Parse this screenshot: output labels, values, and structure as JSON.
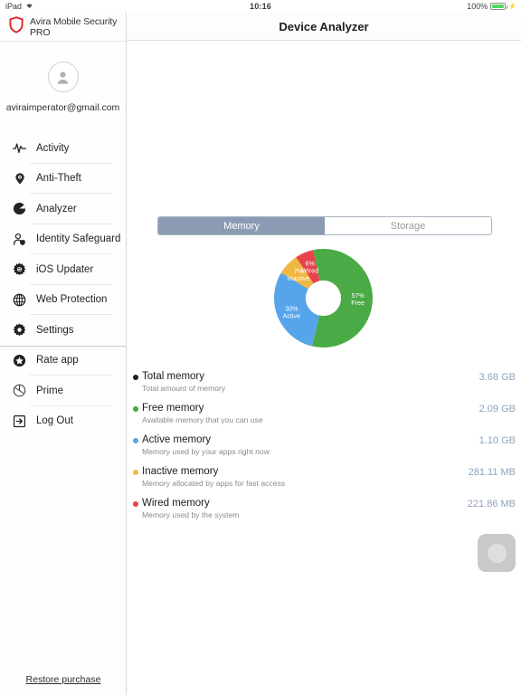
{
  "status_bar": {
    "device": "iPad",
    "wifi_icon": "wifi-icon",
    "time": "10:16",
    "battery_percent": "100%",
    "battery_level": 100,
    "charging": true
  },
  "sidebar": {
    "brand": {
      "logo_icon": "avira-shield-icon",
      "label": "Avira Mobile Security PRO",
      "logo_color": "#e1242a"
    },
    "account": {
      "avatar_icon": "user-avatar-icon",
      "email": "aviraimperator@gmail.com"
    },
    "items": [
      {
        "label": "Activity",
        "icon": "pulse-icon"
      },
      {
        "label": "Anti-Theft",
        "icon": "location-pin-icon"
      },
      {
        "label": "Analyzer",
        "icon": "pie-chart-icon"
      },
      {
        "label": "Identity Safeguard",
        "icon": "person-shield-icon"
      },
      {
        "label": "iOS Updater",
        "icon": "gear-refresh-icon"
      },
      {
        "label": "Web Protection",
        "icon": "globe-icon"
      },
      {
        "label": "Settings",
        "icon": "gear-icon"
      },
      {
        "label": "Rate app",
        "icon": "star-circle-icon"
      },
      {
        "label": "Prime",
        "icon": "prime-clock-icon"
      },
      {
        "label": "Log Out",
        "icon": "logout-arrow-icon"
      }
    ],
    "restore_purchase": "Restore purchase"
  },
  "main": {
    "title": "Device Analyzer",
    "segmented_control": {
      "options": [
        "Memory",
        "Storage"
      ],
      "selected": "Memory",
      "selected_bg": "#8b9bb4"
    },
    "refresh_button": {
      "icon": "refresh-circle-icon",
      "label": ""
    },
    "memory_rows": [
      {
        "title": "Total memory",
        "subtitle": "Total amount of memory",
        "value": "3.68 GB",
        "color": "#1f1f1f"
      },
      {
        "title": "Free memory",
        "subtitle": "Available memory that you can use",
        "value": "2.09 GB",
        "color": "#3fa93f"
      },
      {
        "title": "Active memory",
        "subtitle": "Memory used by your apps right now",
        "value": "1.10 GB",
        "color": "#56a5eb"
      },
      {
        "title": "Inactive memory",
        "subtitle": "Memory allocated by apps for fast access",
        "value": "281.11 MB",
        "color": "#f0b842"
      },
      {
        "title": "Wired memory",
        "subtitle": "Memory used by the system",
        "value": "221.86 MB",
        "color": "#e8424a"
      }
    ]
  },
  "chart_data": {
    "type": "pie",
    "title": "",
    "subtype": "donut",
    "legend": "inline-labels",
    "categories": [
      "Free",
      "Active",
      "Inactive",
      "Wired"
    ],
    "values": [
      57,
      30,
      7,
      6
    ],
    "unit": "%",
    "colors": [
      "#4aaa45",
      "#56a5eb",
      "#f0b842",
      "#e8424a"
    ],
    "labels": [
      "57%\nFree",
      "30%\nActive",
      "7%\nInactive",
      "6%\nWired"
    ],
    "slices": [
      {
        "name": "Free",
        "percent": 57,
        "label_pct": "57%",
        "label_name": "Free",
        "color": "#4aaa45"
      },
      {
        "name": "Active",
        "percent": 30,
        "label_pct": "30%",
        "label_name": "Active",
        "color": "#56a5eb"
      },
      {
        "name": "Inactive",
        "percent": 7,
        "label_pct": "7%",
        "label_name": "Inactive",
        "color": "#f0b842"
      },
      {
        "name": "Wired",
        "percent": 6,
        "label_pct": "6%",
        "label_name": "Wired",
        "color": "#e8424a"
      }
    ],
    "start_angle_deg": -12,
    "inner_radius_ratio": 0.36
  }
}
